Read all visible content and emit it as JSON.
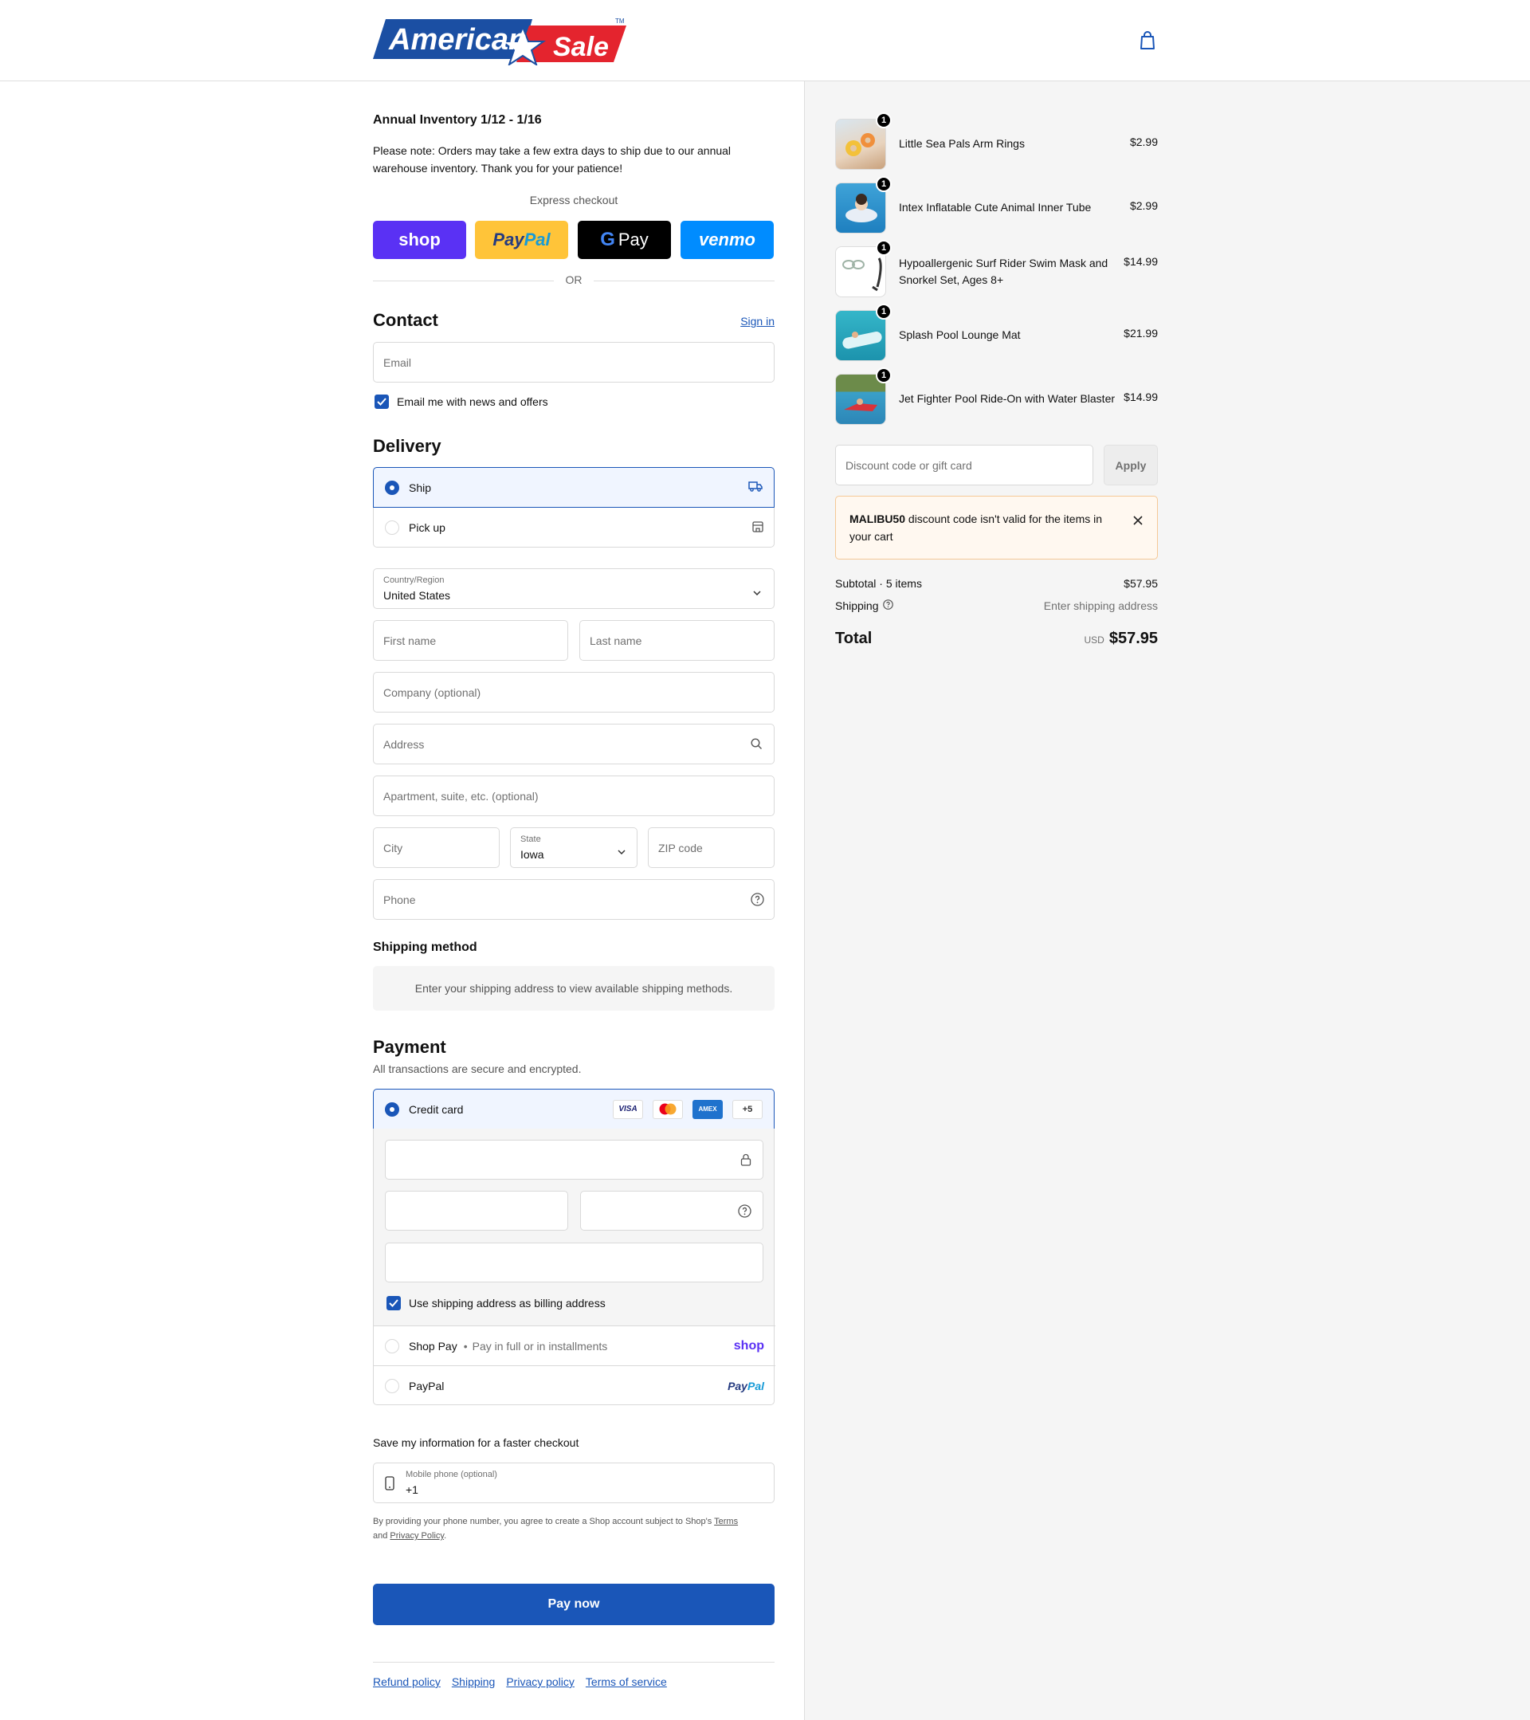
{
  "header": {
    "logo_text_1": "American",
    "logo_text_2": "Sale",
    "logo_tm": "TM"
  },
  "notice": {
    "title": "Annual Inventory 1/12 - 1/16",
    "text": "Please note: Orders may take a few extra days to ship due to our annual warehouse inventory. Thank you for your patience!"
  },
  "express": {
    "label": "Express checkout",
    "shop": "shop",
    "paypal_1": "Pay",
    "paypal_2": "Pal",
    "gpay": "Pay",
    "venmo": "venmo",
    "or": "OR"
  },
  "contact": {
    "title": "Contact",
    "sign_in": "Sign in",
    "email_placeholder": "Email",
    "newsletter_label": "Email me with news and offers"
  },
  "delivery": {
    "title": "Delivery",
    "options": [
      {
        "label": "Ship",
        "selected": true
      },
      {
        "label": "Pick up",
        "selected": false
      }
    ],
    "country_label": "Country/Region",
    "country_value": "United States",
    "first_name": "First name",
    "last_name": "Last name",
    "company": "Company (optional)",
    "address": "Address",
    "apartment": "Apartment, suite, etc. (optional)",
    "city": "City",
    "state_label": "State",
    "state_value": "Iowa",
    "zip": "ZIP code",
    "phone": "Phone"
  },
  "shipping_method": {
    "title": "Shipping method",
    "message": "Enter your shipping address to view available shipping methods."
  },
  "payment": {
    "title": "Payment",
    "subtitle": "All transactions are secure and encrypted.",
    "credit_card": "Credit card",
    "card_badges": [
      "VISA",
      "AMEX",
      "+5"
    ],
    "billing_same": "Use shipping address as billing address",
    "shop_pay": "Shop Pay",
    "shop_pay_sub": "Pay in full or in installments",
    "shop_logo": "shop",
    "paypal": "PayPal",
    "paypal_logo_1": "Pay",
    "paypal_logo_2": "Pal"
  },
  "save_info": {
    "title": "Save my information for a faster checkout",
    "mobile_label": "Mobile phone (optional)",
    "mobile_value": "+1",
    "legal_1": "By providing your phone number, you agree to create a Shop account subject to Shop's ",
    "terms": "Terms",
    "legal_and": "and ",
    "privacy": "Privacy Policy",
    "legal_end": "."
  },
  "pay_now": "Pay now",
  "footer": [
    "Refund policy",
    "Shipping",
    "Privacy policy",
    "Terms of service"
  ],
  "cart": {
    "items": [
      {
        "name": "Little Sea Pals Arm Rings",
        "price": "$2.99",
        "qty": "1"
      },
      {
        "name": "Intex Inflatable Cute Animal Inner Tube",
        "price": "$2.99",
        "qty": "1"
      },
      {
        "name": "Hypoallergenic Surf Rider Swim Mask and Snorkel Set, Ages 8+",
        "price": "$14.99",
        "qty": "1"
      },
      {
        "name": "Splash Pool Lounge Mat",
        "price": "$21.99",
        "qty": "1"
      },
      {
        "name": "Jet Fighter Pool Ride-On with Water Blaster",
        "price": "$14.99",
        "qty": "1"
      }
    ],
    "discount_placeholder": "Discount code or gift card",
    "apply": "Apply",
    "alert_code": "MALIBU50",
    "alert_text": " discount code isn't valid for the items in your cart",
    "subtotal_label": "Subtotal · 5 items",
    "subtotal_value": "$57.95",
    "shipping_label": "Shipping",
    "shipping_value": "Enter shipping address",
    "total_label": "Total",
    "currency": "USD",
    "total_value": "$57.95"
  },
  "colors": {
    "accent": "#1a56b8",
    "shop": "#5a31f4",
    "paypal": "#ffc439",
    "venmo": "#008cff"
  }
}
